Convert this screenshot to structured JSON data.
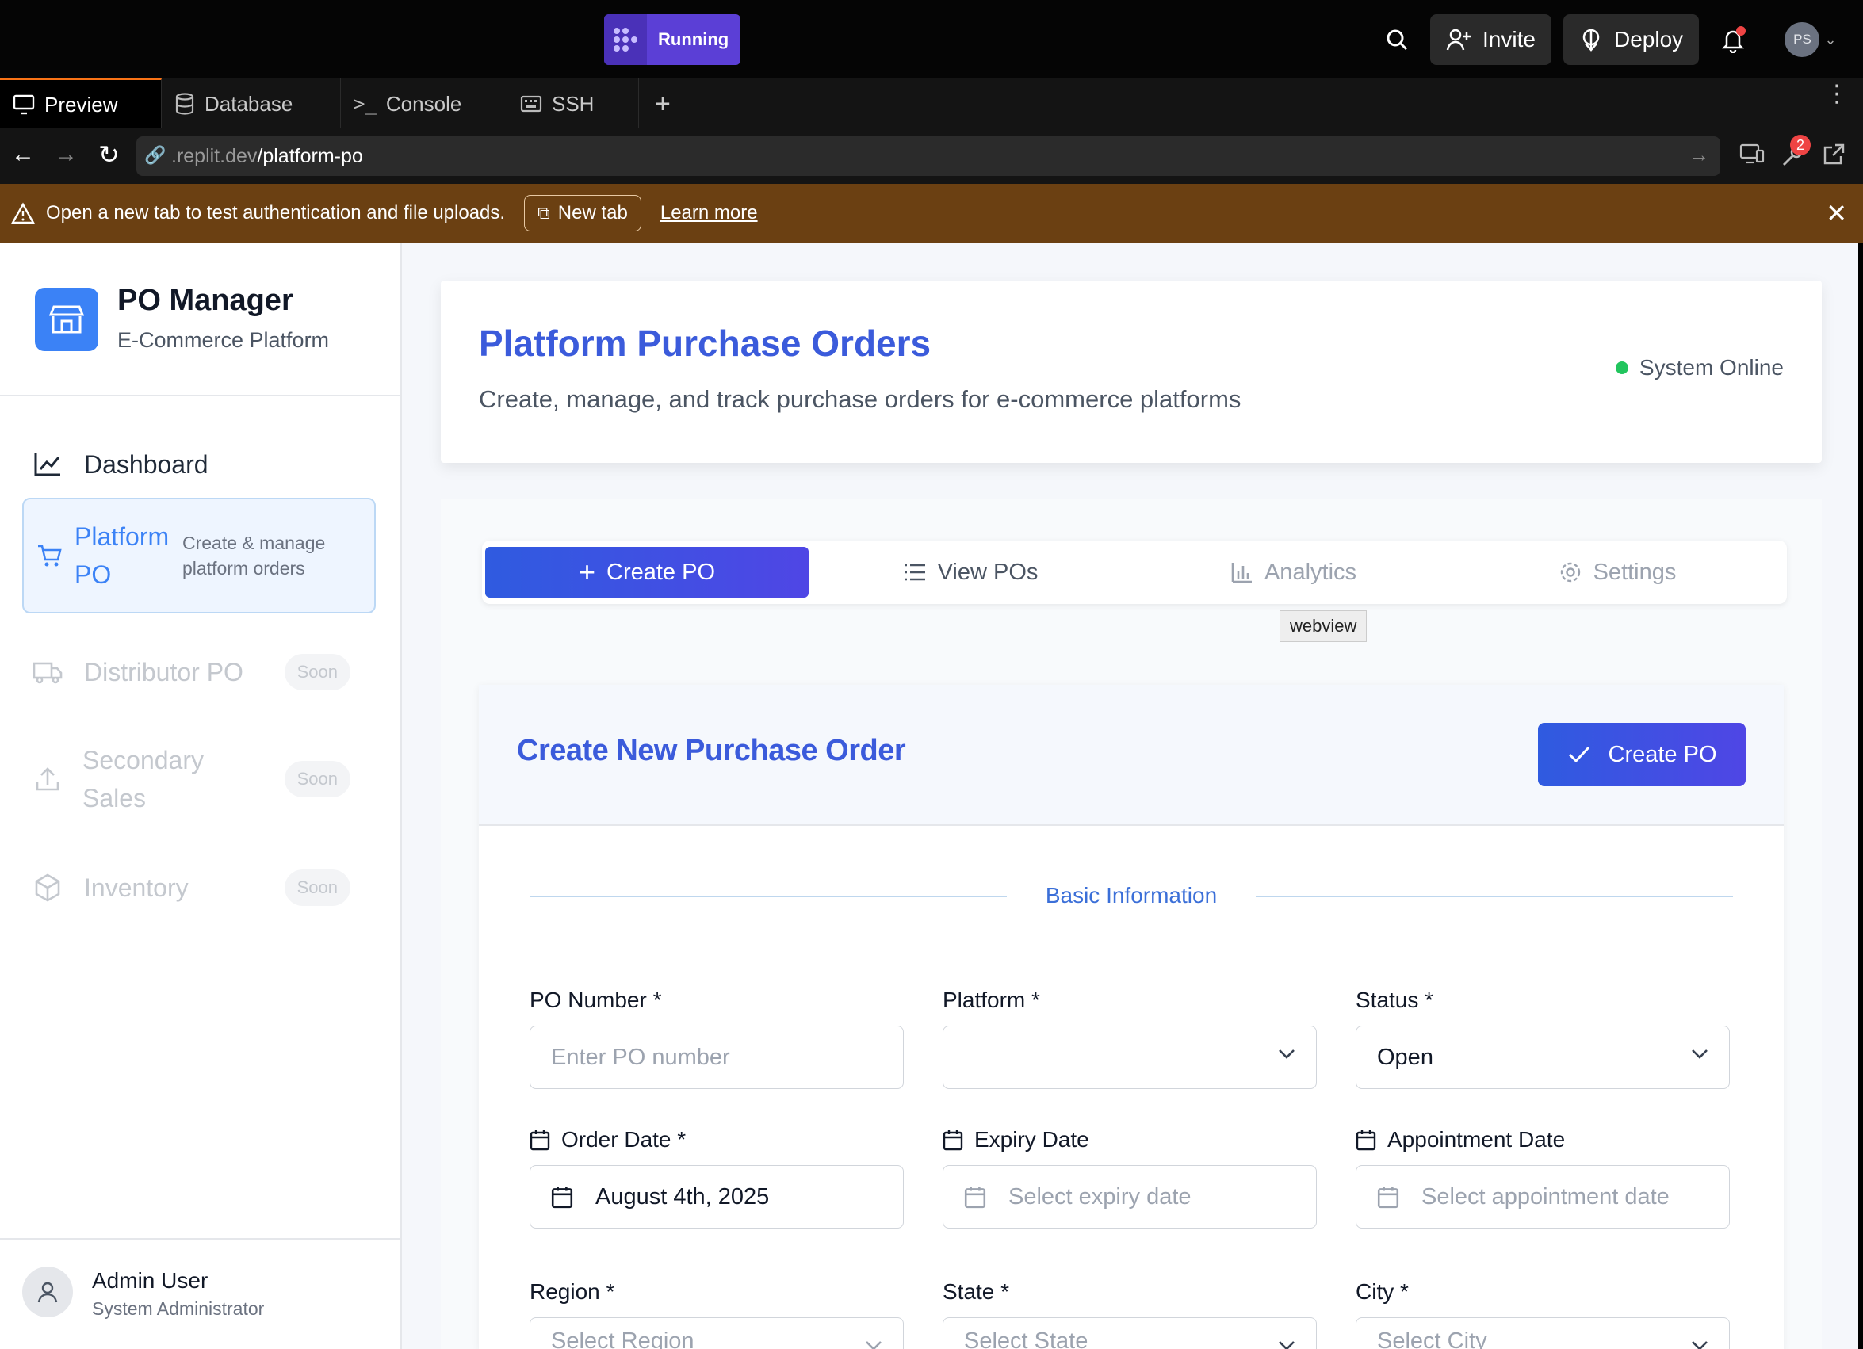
{
  "topbar": {
    "run_status": "Running",
    "invite_label": "Invite",
    "deploy_label": "Deploy",
    "avatar_initials": "PS"
  },
  "tabs": [
    {
      "label": "Preview"
    },
    {
      "label": "Database"
    },
    {
      "label": "Console"
    },
    {
      "label": "SSH"
    }
  ],
  "urlbar": {
    "domain": ".replit.dev",
    "path": "/platform-po",
    "badge_count": "2"
  },
  "warning": {
    "message": "Open a new tab to test authentication and file uploads.",
    "new_tab_label": "New tab",
    "learn_more_label": "Learn more"
  },
  "sidebar": {
    "brand_title": "PO Manager",
    "brand_subtitle": "E-Commerce Platform",
    "items": [
      {
        "label": "Dashboard"
      },
      {
        "label": "Platform PO",
        "description": "Create & manage platform orders"
      },
      {
        "label": "Distributor PO",
        "badge": "Soon"
      },
      {
        "label": "Secondary Sales",
        "badge": "Soon"
      },
      {
        "label": "Inventory",
        "badge": "Soon"
      }
    ],
    "user": {
      "name": "Admin User",
      "role": "System Administrator"
    }
  },
  "header": {
    "title": "Platform Purchase Orders",
    "subtitle": "Create, manage, and track purchase orders for e-commerce platforms",
    "status": "System Online"
  },
  "main_tabs": [
    {
      "label": "Create PO"
    },
    {
      "label": "View POs"
    },
    {
      "label": "Analytics"
    },
    {
      "label": "Settings"
    }
  ],
  "tooltip": "webview",
  "form": {
    "title": "Create New Purchase Order",
    "submit_label": "Create PO",
    "section_title": "Basic Information",
    "fields": {
      "po_number": {
        "label": "PO Number *",
        "placeholder": "Enter PO number"
      },
      "platform": {
        "label": "Platform *",
        "value": ""
      },
      "status": {
        "label": "Status *",
        "value": "Open"
      },
      "order_date": {
        "label": "Order Date *",
        "value": "August 4th, 2025"
      },
      "expiry_date": {
        "label": "Expiry Date",
        "placeholder": "Select expiry date"
      },
      "appointment_date": {
        "label": "Appointment Date",
        "placeholder": "Select appointment date"
      },
      "region": {
        "label": "Region *",
        "placeholder": "Select Region"
      },
      "state": {
        "label": "State *",
        "placeholder": "Select State"
      },
      "city": {
        "label": "City *",
        "placeholder": "Select City"
      }
    }
  },
  "colors": {
    "accent": "#3b5bdb",
    "brand_purple": "#5b3fd6",
    "warning_bg": "#6b4012",
    "online": "#22c55e"
  }
}
